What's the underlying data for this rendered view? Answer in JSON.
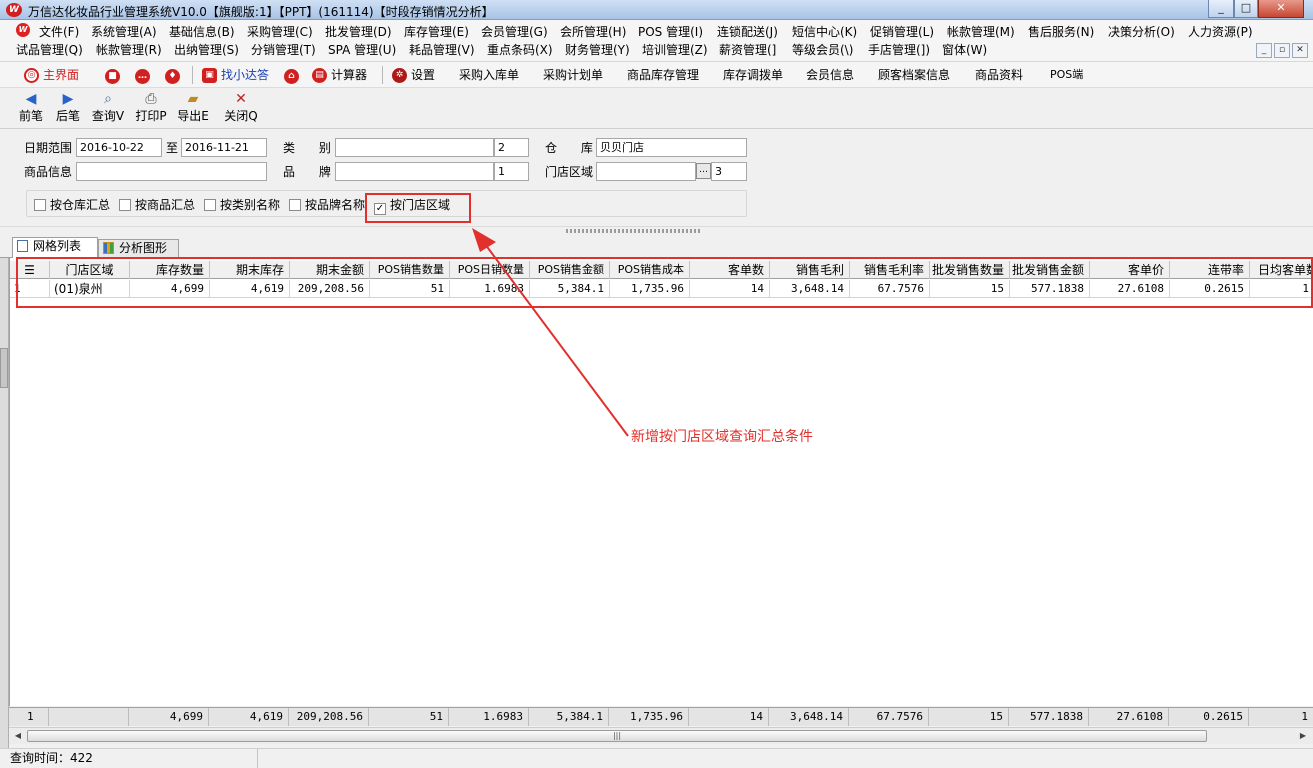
{
  "window": {
    "title": "万信达化妆品行业管理系统V10.0【旗舰版:1】【PPT】(161114)【时段存销情况分析】",
    "min": "_",
    "max": "□",
    "close": "✕"
  },
  "menu": {
    "row1": [
      "文件(F)",
      "系统管理(A)",
      "基础信息(B)",
      "采购管理(C)",
      "批发管理(D)",
      "库存管理(E)",
      "会员管理(G)",
      "会所管理(H)",
      "POS 管理(I)",
      "连锁配送(J)",
      "短信中心(K)",
      "促销管理(L)",
      "帐款管理(M)",
      "售后服务(N)",
      "决策分析(O)",
      "人力资源(P)"
    ],
    "row2": [
      "试品管理(Q)",
      "帐款管理(R)",
      "出纳管理(S)",
      "分销管理(T)",
      "SPA 管理(U)",
      "耗品管理(V)",
      "重点条码(X)",
      "财务管理(Y)",
      "培训管理(Z)",
      "薪资管理(]",
      "等级会员(\\)",
      "手店管理(])",
      "窗体(W)"
    ],
    "mdi": [
      "_",
      "▫",
      "✕"
    ]
  },
  "quickbar": {
    "items": [
      "主界面",
      "找小达答",
      "计算器",
      "设置",
      "采购入库单",
      "采购计划单",
      "商品库存管理",
      "库存调拨单",
      "会员信息",
      "顾客档案信息",
      "商品资料",
      "POS端"
    ]
  },
  "toolbar": {
    "prev": "前笔",
    "next": "后笔",
    "query": "查询V",
    "print": "打印P",
    "export": "导出E",
    "close": "关闭Q"
  },
  "filter": {
    "date_label": "日期范围",
    "date_from": "2016-10-22",
    "date_to_label": "至",
    "date_to": "2016-11-21",
    "category_label": "类 别",
    "category_value": "",
    "category_code": "2",
    "warehouse_label": "仓 库",
    "warehouse_value": "贝贝门店",
    "product_label": "商品信息",
    "product_value": "",
    "brand_label": "品 牌",
    "brand_value": "",
    "brand_code": "1",
    "region_label": "门店区域",
    "region_value": "",
    "region_btn": "…",
    "region_code": "3",
    "checkboxes": [
      {
        "label": "按仓库汇总",
        "checked": false
      },
      {
        "label": "按商品汇总",
        "checked": false
      },
      {
        "label": "按类别名称",
        "checked": false
      },
      {
        "label": "按品牌名称",
        "checked": false
      },
      {
        "label": "按门店区域",
        "checked": true
      }
    ]
  },
  "tabs": [
    "网格列表",
    "分析图形"
  ],
  "grid": {
    "columns": [
      "门店区域",
      "库存数量",
      "期末库存",
      "期末金额",
      "POS销售数量",
      "POS日销数量",
      "POS销售金额",
      "POS销售成本",
      "客单数",
      "销售毛利",
      "销售毛利率",
      "批发销售数量",
      "批发销售金额",
      "客单价",
      "连带率",
      "日均客单数"
    ],
    "rows": [
      {
        "index": "1",
        "cells": [
          "(01)泉州",
          "4,699",
          "4,619",
          "209,208.56",
          "51",
          "1.6983",
          "5,384.1",
          "1,735.96",
          "14",
          "3,648.14",
          "67.7576",
          "15",
          "577.1838",
          "27.6108",
          "0.2615",
          "1"
        ]
      }
    ],
    "footer": {
      "index": "1",
      "cells": [
        "",
        "4,699",
        "4,619",
        "209,208.56",
        "51",
        "1.6983",
        "5,384.1",
        "1,735.96",
        "14",
        "3,648.14",
        "67.7576",
        "15",
        "577.1838",
        "27.6108",
        "0.2615",
        "1"
      ]
    }
  },
  "status": {
    "query_time": "查询时间：422"
  },
  "annotation": {
    "text": "新增按门店区域查询汇总条件",
    "color": "#e2302c"
  }
}
